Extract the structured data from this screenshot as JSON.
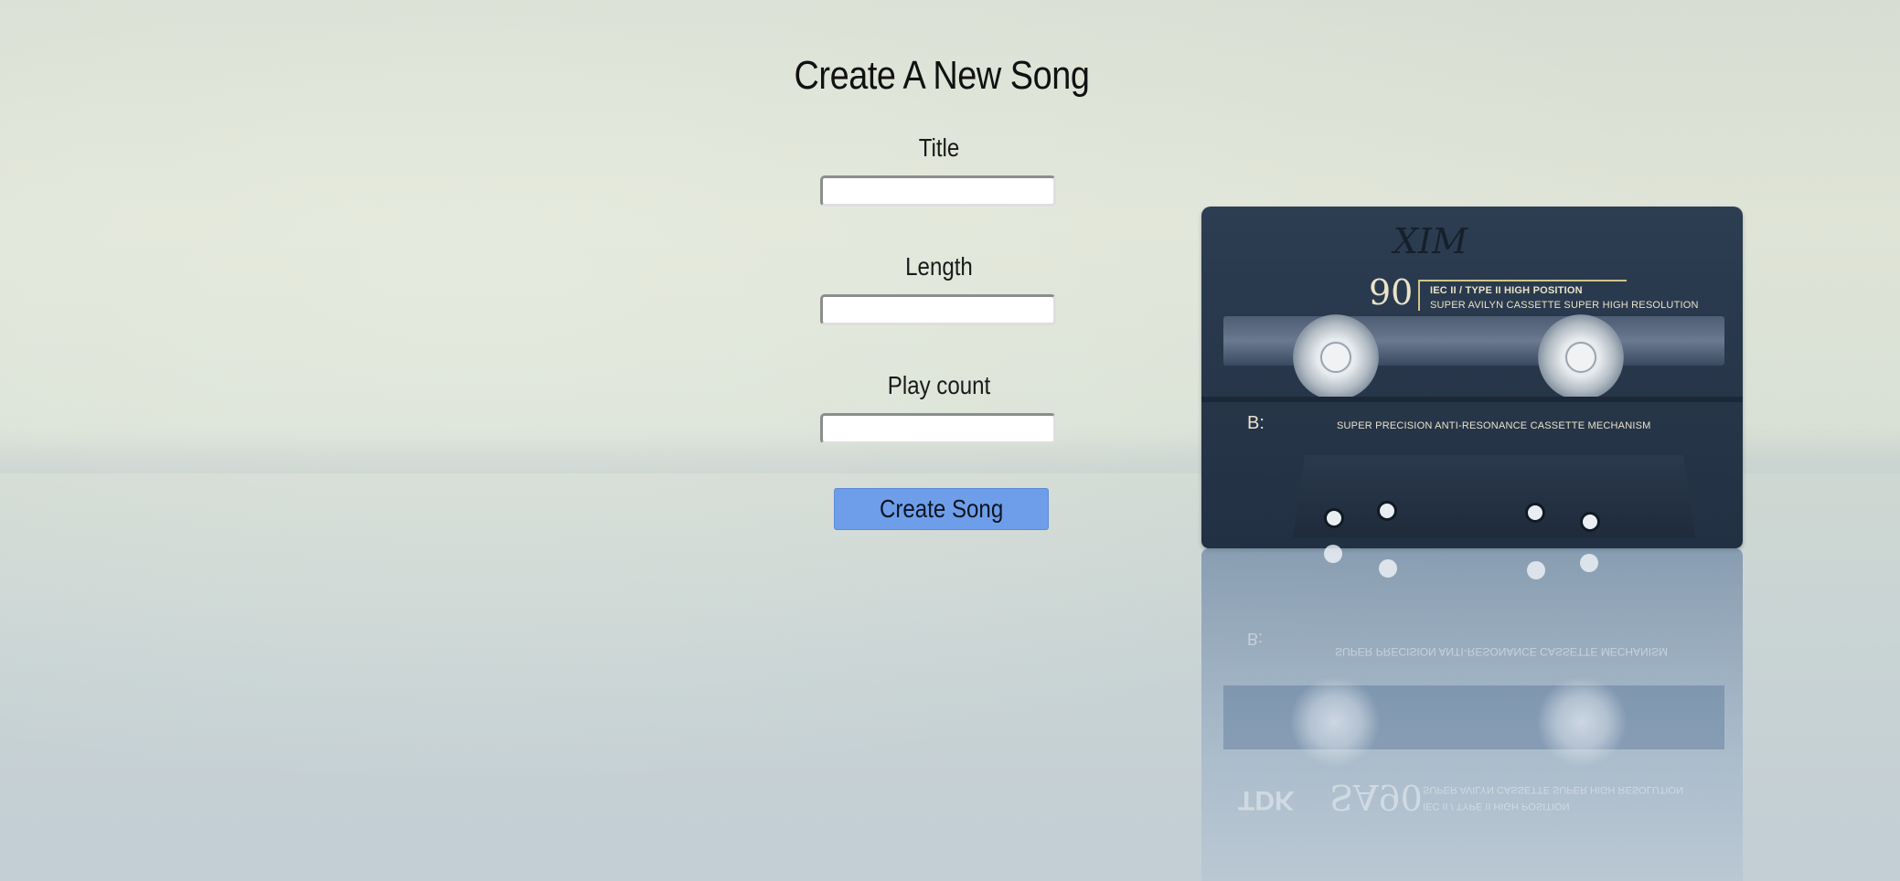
{
  "page": {
    "title": "Create A New Song"
  },
  "form": {
    "fields": [
      {
        "label": "Title",
        "value": "",
        "placeholder": ""
      },
      {
        "label": "Length",
        "value": "",
        "placeholder": ""
      },
      {
        "label": "Play count",
        "value": "",
        "placeholder": ""
      }
    ],
    "submit_label": "Create Song"
  },
  "cassette_image": {
    "handwritten": "XIM",
    "number": "90",
    "type_text": "IEC II / TYPE II  HIGH POSITION",
    "sub_text": "SUPER AVILYN CASSETTE SUPER HIGH RESOLUTION",
    "side_label": "B:",
    "mechanism_text": "SUPER PRECISION ANTI-RESONANCE CASSETTE MECHANISM",
    "reflection_brand": "TDK",
    "reflection_model": "SA90"
  },
  "colors": {
    "button_bg": "#6e9ee9",
    "cassette_body": "#263548",
    "cassette_text": "#e9e3c9"
  }
}
